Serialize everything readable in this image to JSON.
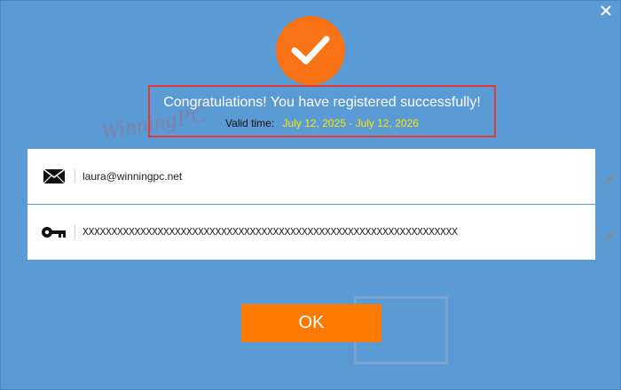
{
  "dialog": {
    "title": "Congratulations! You have registered successfully!",
    "valid_label": "Valid time:",
    "valid_dates": "July 12, 2025 - July 12, 2026"
  },
  "account": {
    "email": "laura@winningpc.net",
    "license_key": "XXXXXXXXXXXXXXXXXXXXXXXXXXXXXXXXXXXXXXXXXXXXXXXXXXXXXXXXXXXXXXXXX"
  },
  "buttons": {
    "ok_label": "OK"
  },
  "icons": {
    "close": "close-icon",
    "success": "checkmark-icon",
    "email": "envelope-icon",
    "key": "key-icon",
    "edit": "pencil-icon"
  },
  "colors": {
    "background": "#5b9bd5",
    "accent": "#ff7a00",
    "highlight_border": "#e53935",
    "valid_dates": "#ffe600"
  },
  "watermark": {
    "text": "WinningPC"
  }
}
